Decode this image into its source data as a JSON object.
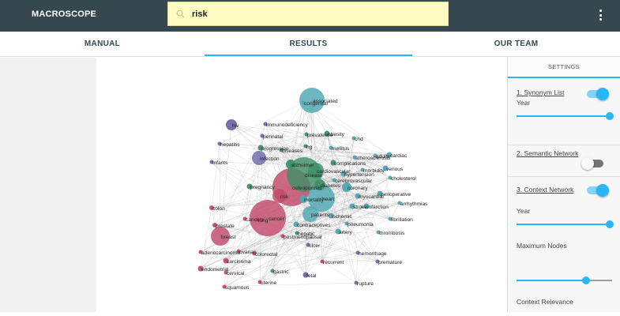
{
  "header": {
    "brand": "MACROSCOPE",
    "search": {
      "value": "risk",
      "placeholder": ""
    }
  },
  "tabs": [
    {
      "label": "MANUAL",
      "active": false
    },
    {
      "label": "RESULTS",
      "active": true
    },
    {
      "label": "OUR TEAM",
      "active": false
    }
  ],
  "settings": {
    "title": "SETTINGS",
    "synonym_list": {
      "label": "1. Synonym List",
      "enabled": true,
      "year_label": "Year",
      "year_level": 1.0
    },
    "semantic_network": {
      "label": "2. Semantic Network",
      "enabled": false
    },
    "context_network": {
      "label": "3. Context Network",
      "enabled": true,
      "year_label": "Year",
      "year_level": 1.0,
      "max_nodes_label": "Maximum Nodes",
      "max_nodes_level": 0.73,
      "relevance_label": "Context Relevance"
    }
  },
  "colors": {
    "topbar": "#37474f",
    "accent": "#29b6f6",
    "teal": "#4ea7b3",
    "pink": "#c24a6b",
    "green": "#3f8f68",
    "purple": "#6d69a8"
  },
  "network": {
    "nodes": [
      {
        "label": "congenital",
        "group": "teal"
      },
      {
        "label": "associated",
        "group": "teal"
      },
      {
        "label": "hiv",
        "group": "purple"
      },
      {
        "label": "immunodeficiency",
        "group": "purple"
      },
      {
        "label": "perinatal",
        "group": "purple"
      },
      {
        "label": "prevalence",
        "group": "green"
      },
      {
        "label": "obesity",
        "group": "green"
      },
      {
        "label": "hepatitis",
        "group": "purple"
      },
      {
        "label": "progression",
        "group": "green"
      },
      {
        "label": "diseases",
        "group": "green"
      },
      {
        "label": "hg",
        "group": "green"
      },
      {
        "label": "mellitus",
        "group": "teal"
      },
      {
        "label": "chd",
        "group": "teal"
      },
      {
        "label": "infection",
        "group": "purple"
      },
      {
        "label": "atherosclerosis",
        "group": "teal"
      },
      {
        "label": "adults",
        "group": "teal"
      },
      {
        "label": "cardiac",
        "group": "teal"
      },
      {
        "label": "infants",
        "group": "purple"
      },
      {
        "label": "alzheimer",
        "group": "green"
      },
      {
        "label": "complications",
        "group": "green"
      },
      {
        "label": "cardiovascular",
        "group": "green"
      },
      {
        "label": "morbidity",
        "group": "teal"
      },
      {
        "label": "venous",
        "group": "teal"
      },
      {
        "label": "hypertension",
        "group": "teal"
      },
      {
        "label": "disease",
        "group": "green"
      },
      {
        "label": "cerebrovascular",
        "group": "teal"
      },
      {
        "label": "cholesterol",
        "group": "teal"
      },
      {
        "label": "pregnancy",
        "group": "green"
      },
      {
        "label": "osteoporosis",
        "group": "pink"
      },
      {
        "label": "diabetes",
        "group": "green"
      },
      {
        "label": "coronary",
        "group": "teal"
      },
      {
        "label": "risk",
        "group": "pink"
      },
      {
        "label": "myocardial",
        "group": "teal"
      },
      {
        "label": "perioperative",
        "group": "teal"
      },
      {
        "label": "mortality",
        "group": "teal"
      },
      {
        "label": "heart",
        "group": "teal"
      },
      {
        "label": "arrhythmias",
        "group": "teal"
      },
      {
        "label": "colon",
        "group": "pink"
      },
      {
        "label": "stroke",
        "group": "teal"
      },
      {
        "label": "infarction",
        "group": "teal"
      },
      {
        "label": "patients",
        "group": "teal"
      },
      {
        "label": "ischemic",
        "group": "teal"
      },
      {
        "label": "cancer",
        "group": "pink"
      },
      {
        "label": "cancers",
        "group": "pink"
      },
      {
        "label": "lung",
        "group": "pink"
      },
      {
        "label": "fibrillation",
        "group": "teal"
      },
      {
        "label": "contraceptives",
        "group": "teal"
      },
      {
        "label": "pneumonia",
        "group": "teal"
      },
      {
        "label": "prostate",
        "group": "pink"
      },
      {
        "label": "hepatic",
        "group": "green"
      },
      {
        "label": "postmenopausal",
        "group": "pink"
      },
      {
        "label": "artery",
        "group": "teal"
      },
      {
        "label": "thrombosis",
        "group": "teal"
      },
      {
        "label": "breast",
        "group": "pink"
      },
      {
        "label": "ulcer",
        "group": "purple"
      },
      {
        "label": "adenocarcinoma",
        "group": "pink"
      },
      {
        "label": "ovarian",
        "group": "pink"
      },
      {
        "label": "colorectal",
        "group": "pink"
      },
      {
        "label": "hemorrhage",
        "group": "purple"
      },
      {
        "label": "carcinoma",
        "group": "pink"
      },
      {
        "label": "recurrent",
        "group": "pink"
      },
      {
        "label": "premature",
        "group": "purple"
      },
      {
        "label": "endometrial",
        "group": "pink"
      },
      {
        "label": "cervical",
        "group": "pink"
      },
      {
        "label": "gastric",
        "group": "green"
      },
      {
        "label": "fetal",
        "group": "purple"
      },
      {
        "label": "uterine",
        "group": "pink"
      },
      {
        "label": "rupture",
        "group": "purple"
      },
      {
        "label": "squamous",
        "group": "pink"
      }
    ]
  }
}
